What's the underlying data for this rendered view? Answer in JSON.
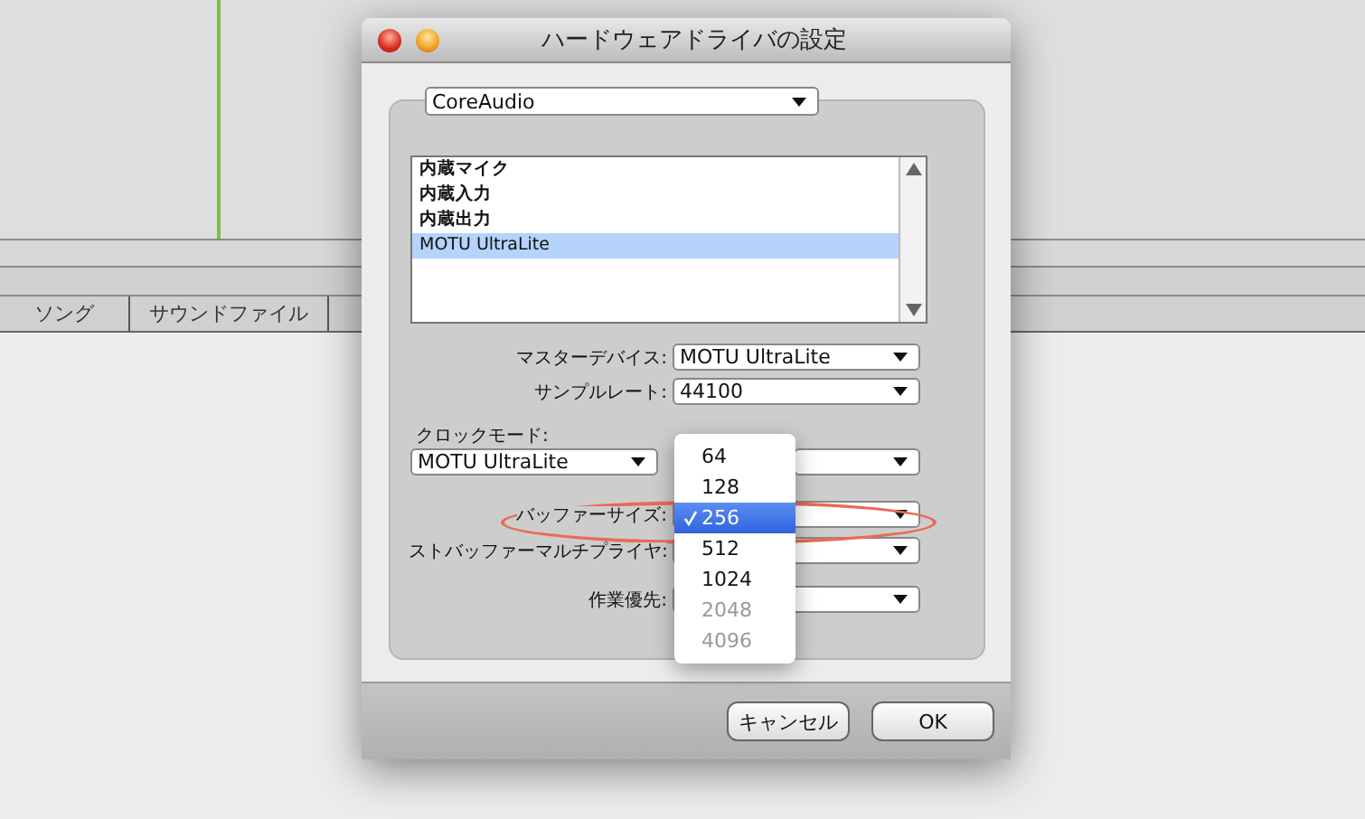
{
  "window": {
    "title": "ハードウェアドライバの設定"
  },
  "background_tabs": [
    {
      "label": "ソング"
    },
    {
      "label": "サウンドファイル"
    }
  ],
  "driver": {
    "value": "CoreAudio"
  },
  "devices": [
    {
      "label": "内蔵マイク",
      "selected": false
    },
    {
      "label": "内蔵入力",
      "selected": false
    },
    {
      "label": "内蔵出力",
      "selected": false
    },
    {
      "label": "MOTU UltraLite",
      "selected": true
    }
  ],
  "fields": [
    {
      "kind": "inline",
      "label": "マスターデバイス:",
      "value": "MOTU UltraLite"
    },
    {
      "kind": "inline",
      "label": "サンプルレート:",
      "value": "44100"
    },
    {
      "kind": "stacked",
      "label": "クロックモード:",
      "value": "MOTU UltraLite"
    },
    {
      "kind": "inline",
      "label": "バッファーサイズ:"
    },
    {
      "kind": "inline",
      "label": "ストバッファーマルチプライヤ:"
    },
    {
      "kind": "inline",
      "label": "作業優先:"
    }
  ],
  "popup_menu": [
    {
      "label": "64",
      "selected": false,
      "disabled": false
    },
    {
      "label": "128",
      "selected": false,
      "disabled": false
    },
    {
      "label": "256",
      "selected": true,
      "disabled": false
    },
    {
      "label": "512",
      "selected": false,
      "disabled": false
    },
    {
      "label": "1024",
      "selected": false,
      "disabled": false
    },
    {
      "label": "2048",
      "selected": false,
      "disabled": true
    },
    {
      "label": "4096",
      "selected": false,
      "disabled": true
    }
  ],
  "buttons": [
    "キャンセル",
    "OK"
  ]
}
